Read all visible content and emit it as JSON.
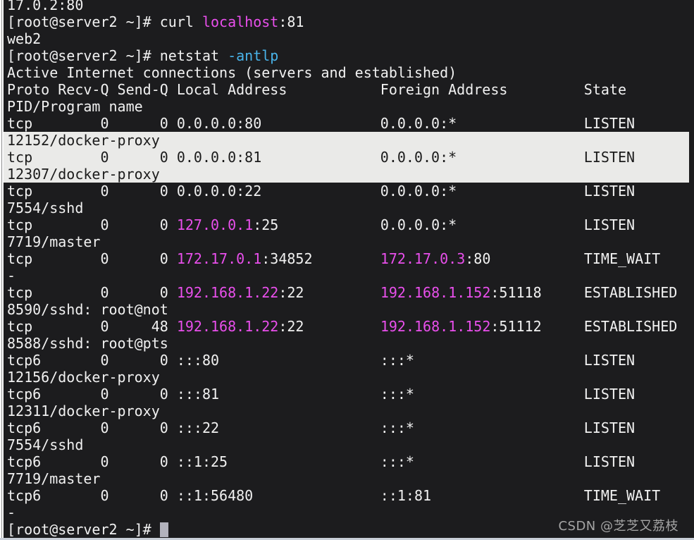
{
  "palette": {
    "background": "#1c1c1e",
    "foreground": "#f1f1f1",
    "magenta": "#e94fec",
    "cyan": "#49b3e9",
    "selection_background": "#eaeae8",
    "selection_foreground": "#1b1b1b",
    "cursor": "#b2b2bc",
    "watermark_gray": "#a5a5a5",
    "window_edge_white": "#ffffff",
    "window_edge_gray": "#8f8f8f",
    "bottom_bar": "#c9cfd8"
  },
  "watermark": {
    "text": "CSDN @芝芝又荔枝"
  },
  "terminal": {
    "lines": [
      {
        "name": "clipped-output-line",
        "segments": [
          {
            "t": "17.0.2:80"
          }
        ]
      },
      {
        "name": "prompt-curl-command",
        "segments": [
          {
            "t": "[root@server2 ~]# curl "
          },
          {
            "t": "localhost",
            "c": "magenta"
          },
          {
            "t": ":81"
          }
        ]
      },
      {
        "name": "curl-output",
        "segments": [
          {
            "t": "web2"
          }
        ]
      },
      {
        "name": "prompt-netstat-command",
        "segments": [
          {
            "t": "[root@server2 ~]# netstat "
          },
          {
            "t": "-antlp",
            "c": "cyan"
          }
        ]
      },
      {
        "name": "netstat-banner",
        "segments": [
          {
            "t": "Active Internet connections (servers and established)"
          }
        ]
      },
      {
        "name": "netstat-header",
        "segments": [
          {
            "t": "Proto Recv-Q Send-Q Local Address           Foreign Address         State"
          }
        ]
      },
      {
        "name": "netstat-header-wrap",
        "segments": [
          {
            "t": "PID/Program name"
          }
        ]
      },
      {
        "name": "netstat-row",
        "segments": [
          {
            "t": "tcp        0      0 0.0.0.0:80              0.0.0.0:*               LISTEN"
          }
        ]
      },
      {
        "name": "netstat-pid-line",
        "hl": true,
        "segments": [
          {
            "t": "12152/docker-proxy"
          }
        ]
      },
      {
        "name": "netstat-row",
        "hl": true,
        "segments": [
          {
            "t": "tcp        0      0 0.0.0.0:81              0.0.0.0:*               LISTEN"
          }
        ]
      },
      {
        "name": "netstat-pid-line",
        "hl": true,
        "segments": [
          {
            "t": "12307/docker-proxy"
          }
        ]
      },
      {
        "name": "netstat-row",
        "segments": [
          {
            "t": "tcp        0      0 0.0.0.0:22              0.0.0.0:*               LISTEN"
          }
        ]
      },
      {
        "name": "netstat-pid-line",
        "segments": [
          {
            "t": "7554/sshd"
          }
        ]
      },
      {
        "name": "netstat-row",
        "segments": [
          {
            "t": "tcp        0      0 "
          },
          {
            "t": "127.0.0.1",
            "c": "magenta"
          },
          {
            "t": ":25            0.0.0.0:*               LISTEN"
          }
        ]
      },
      {
        "name": "netstat-pid-line",
        "segments": [
          {
            "t": "7719/master"
          }
        ]
      },
      {
        "name": "netstat-row",
        "segments": [
          {
            "t": "tcp        0      0 "
          },
          {
            "t": "172.17.0.1",
            "c": "magenta"
          },
          {
            "t": ":34852        "
          },
          {
            "t": "172.17.0.3",
            "c": "magenta"
          },
          {
            "t": ":80           TIME_WAIT"
          }
        ]
      },
      {
        "name": "netstat-pid-line",
        "segments": [
          {
            "t": "-"
          }
        ]
      },
      {
        "name": "netstat-row",
        "segments": [
          {
            "t": "tcp        0      0 "
          },
          {
            "t": "192.168.1.22",
            "c": "magenta"
          },
          {
            "t": ":22         "
          },
          {
            "t": "192.168.1.152",
            "c": "magenta"
          },
          {
            "t": ":51118     ESTABLISHED"
          }
        ]
      },
      {
        "name": "netstat-pid-line",
        "segments": [
          {
            "t": "8590/sshd: root@not"
          }
        ]
      },
      {
        "name": "netstat-row",
        "segments": [
          {
            "t": "tcp        0     48 "
          },
          {
            "t": "192.168.1.22",
            "c": "magenta"
          },
          {
            "t": ":22         "
          },
          {
            "t": "192.168.1.152",
            "c": "magenta"
          },
          {
            "t": ":51112     ESTABLISHED"
          }
        ]
      },
      {
        "name": "netstat-pid-line",
        "segments": [
          {
            "t": "8588/sshd: root@pts"
          }
        ]
      },
      {
        "name": "netstat-row",
        "segments": [
          {
            "t": "tcp6       0      0 :::80                   :::*                    LISTEN"
          }
        ]
      },
      {
        "name": "netstat-pid-line",
        "segments": [
          {
            "t": "12156/docker-proxy"
          }
        ]
      },
      {
        "name": "netstat-row",
        "segments": [
          {
            "t": "tcp6       0      0 :::81                   :::*                    LISTEN"
          }
        ]
      },
      {
        "name": "netstat-pid-line",
        "segments": [
          {
            "t": "12311/docker-proxy"
          }
        ]
      },
      {
        "name": "netstat-row",
        "segments": [
          {
            "t": "tcp6       0      0 :::22                   :::*                    LISTEN"
          }
        ]
      },
      {
        "name": "netstat-pid-line",
        "segments": [
          {
            "t": "7554/sshd"
          }
        ]
      },
      {
        "name": "netstat-row",
        "segments": [
          {
            "t": "tcp6       0      0 ::1:25                  :::*                    LISTEN"
          }
        ]
      },
      {
        "name": "netstat-pid-line",
        "segments": [
          {
            "t": "7719/master"
          }
        ]
      },
      {
        "name": "netstat-row",
        "segments": [
          {
            "t": "tcp6       0      0 ::1:56480               ::1:81                  TIME_WAIT"
          }
        ]
      },
      {
        "name": "netstat-pid-line",
        "segments": [
          {
            "t": "-"
          }
        ]
      },
      {
        "name": "prompt-idle",
        "cursor": true,
        "segments": [
          {
            "t": "[root@server2 ~]# "
          }
        ]
      }
    ]
  }
}
